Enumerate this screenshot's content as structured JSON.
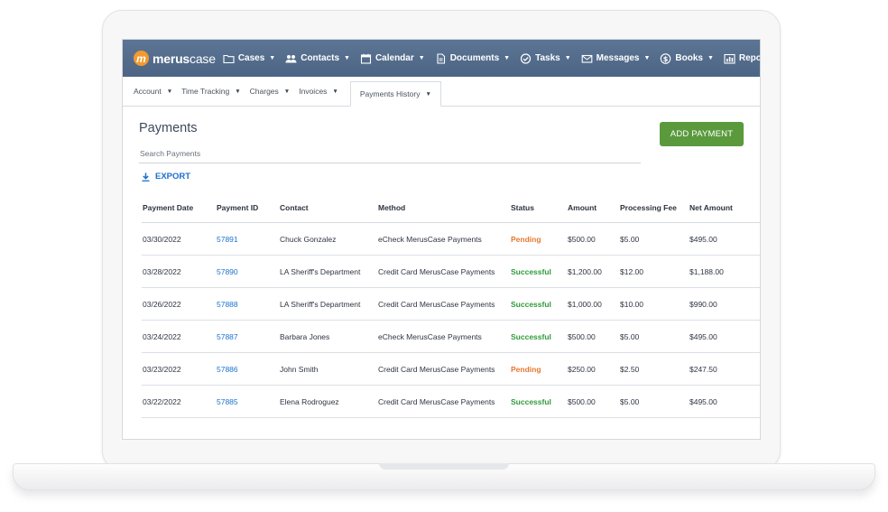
{
  "app": {
    "logo_bold": "merus",
    "logo_light": "case",
    "logo_mark": "m"
  },
  "nav": {
    "items": [
      {
        "label": "Cases",
        "icon": "folder-icon"
      },
      {
        "label": "Contacts",
        "icon": "people-icon"
      },
      {
        "label": "Calendar",
        "icon": "calendar-icon"
      },
      {
        "label": "Documents",
        "icon": "document-icon"
      },
      {
        "label": "Tasks",
        "icon": "check-circle-icon"
      },
      {
        "label": "Messages",
        "icon": "envelope-icon"
      },
      {
        "label": "Books",
        "icon": "dollar-circle-icon"
      },
      {
        "label": "Reports",
        "icon": "bar-chart-icon"
      }
    ]
  },
  "subnav": {
    "items": [
      {
        "label": "Account"
      },
      {
        "label": "Time Tracking"
      },
      {
        "label": "Charges"
      },
      {
        "label": "Invoices"
      },
      {
        "label": "Payments History",
        "active": true
      }
    ]
  },
  "page": {
    "title": "Payments",
    "search_placeholder": "Search Payments",
    "add_button": "ADD PAYMENT",
    "export_label": "EXPORT"
  },
  "table": {
    "headers": [
      "Payment Date",
      "Payment ID",
      "Contact",
      "Method",
      "Status",
      "Amount",
      "Processing Fee",
      "Net Amount"
    ],
    "rows": [
      {
        "date": "03/30/2022",
        "id": "57891",
        "contact": "Chuck Gonzalez",
        "method": "eCheck MerusCase Payments",
        "status": "Pending",
        "amount": "$500.00",
        "fee": "$5.00",
        "net": "$495.00"
      },
      {
        "date": "03/28/2022",
        "id": "57890",
        "contact": "LA Sheriff's Department",
        "method": "Credit Card MerusCase Payments",
        "status": "Successful",
        "amount": "$1,200.00",
        "fee": "$12.00",
        "net": "$1,188.00"
      },
      {
        "date": "03/26/2022",
        "id": "57888",
        "contact": "LA Sheriff's Department",
        "method": "Credit Card MerusCase Payments",
        "status": "Successful",
        "amount": "$1,000.00",
        "fee": "$10.00",
        "net": "$990.00"
      },
      {
        "date": "03/24/2022",
        "id": "57887",
        "contact": "Barbara Jones",
        "method": "eCheck MerusCase Payments",
        "status": "Successful",
        "amount": "$500.00",
        "fee": "$5.00",
        "net": "$495.00"
      },
      {
        "date": "03/23/2022",
        "id": "57886",
        "contact": "John Smith",
        "method": "Credit Card MerusCase Payments",
        "status": "Pending",
        "amount": "$250.00",
        "fee": "$2.50",
        "net": "$247.50"
      },
      {
        "date": "03/22/2022",
        "id": "57885",
        "contact": "Elena Rodroguez",
        "method": "Credit Card MerusCase Payments",
        "status": "Successful",
        "amount": "$500.00",
        "fee": "$5.00",
        "net": "$495.00"
      }
    ]
  },
  "colors": {
    "nav_bg": "#506987",
    "accent_green": "#5a9a3c",
    "link_blue": "#1a73d1",
    "pending_orange": "#e8772e",
    "success_green": "#2e9a3a",
    "logo_orange": "#f29a2e"
  }
}
